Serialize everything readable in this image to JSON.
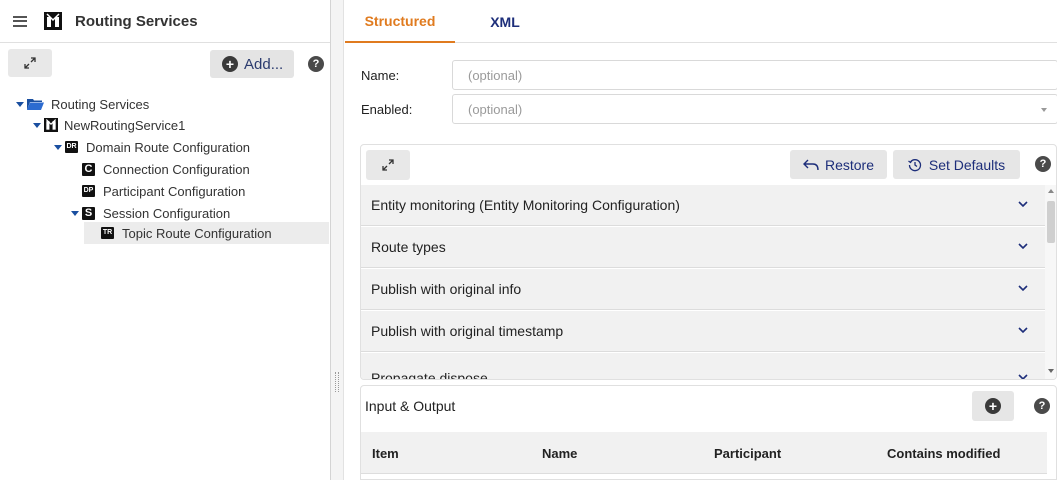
{
  "app": {
    "title": "Routing Services"
  },
  "left_toolbar": {
    "add_label": "Add...",
    "help": "?"
  },
  "tree": [
    {
      "label": "Routing Services",
      "icon": "folder-open-icon"
    },
    {
      "label": "NewRoutingService1",
      "icon": "routing-service-icon"
    },
    {
      "label": "Domain Route Configuration",
      "badge": "DR"
    },
    {
      "label": "Connection Configuration",
      "badge": "C"
    },
    {
      "label": "Participant Configuration",
      "badge": "DP"
    },
    {
      "label": "Session Configuration",
      "badge": "S"
    },
    {
      "label": "Topic Route Configuration",
      "badge": "TR"
    }
  ],
  "tabs": {
    "structured": "Structured",
    "xml": "XML"
  },
  "form": {
    "name_label": "Name:",
    "name_placeholder": "(optional)",
    "enabled_label": "Enabled:",
    "enabled_placeholder": "(optional)"
  },
  "config": {
    "restore_label": "Restore",
    "defaults_label": "Set Defaults",
    "help": "?",
    "sections": [
      "Entity monitoring (Entity Monitoring Configuration)",
      "Route types",
      "Publish with original info",
      "Publish with original timestamp",
      "Propagate dispose"
    ]
  },
  "io": {
    "title": "Input & Output",
    "help": "?",
    "columns": [
      "Item",
      "Name",
      "Participant",
      "Contains modified"
    ]
  },
  "colors": {
    "accent": "#e07b1f",
    "primary": "#1d2e7a",
    "tree_caret": "#1a4fa0"
  }
}
